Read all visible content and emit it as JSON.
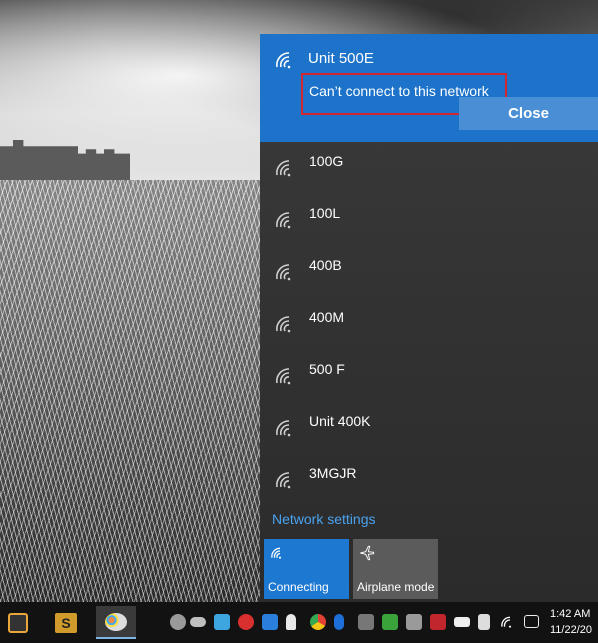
{
  "flyout": {
    "active_network": {
      "ssid": "Unit 500E",
      "error": "Can’t connect to this network",
      "close_label": "Close"
    },
    "networks": [
      {
        "name": "100G"
      },
      {
        "name": "100L"
      },
      {
        "name": "400B"
      },
      {
        "name": "400M"
      },
      {
        "name": "500 F"
      },
      {
        "name": "Unit 400K"
      },
      {
        "name": "3MGJR"
      }
    ],
    "network_settings_label": "Network settings",
    "tiles": {
      "wifi": {
        "label": "Connecting"
      },
      "airplane": {
        "label": "Airplane mode"
      }
    }
  },
  "taskbar": {
    "clock": {
      "time": "1:42 AM",
      "date": "11/22/20"
    }
  },
  "colors": {
    "accent": "#1c73c9",
    "error_outline": "#d3262f",
    "link": "#4aa3f0"
  }
}
